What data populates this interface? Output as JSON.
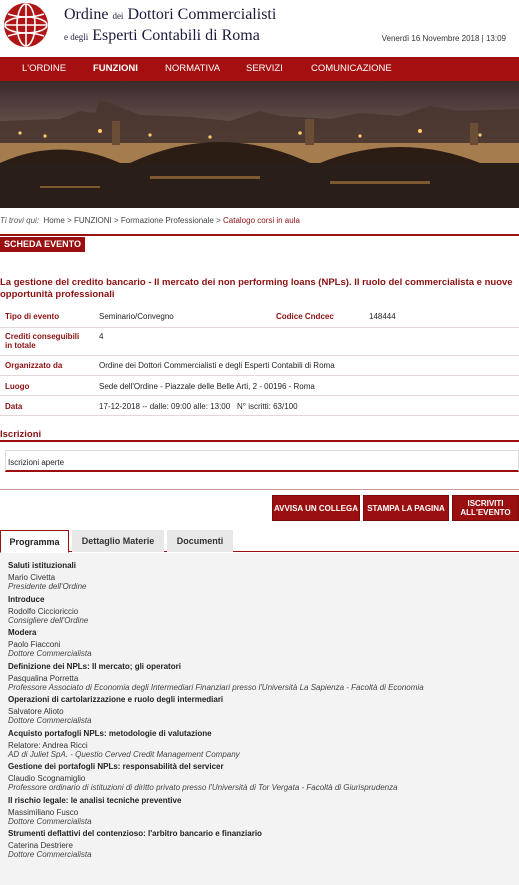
{
  "header": {
    "org_line1": "Ordine",
    "org_line1_small": "dei",
    "org_line1_rest": "Dottori Commercialisti",
    "org_line2_small": "e degli",
    "org_line2_rest": "Esperti Contabili di Roma",
    "date": "Venerdì 16 Novembre 2018 | 13:09",
    "logo_icon": "globe-logo-icon"
  },
  "nav": [
    "L'ORDINE",
    "FUNZIONI",
    "NORMATIVA",
    "SERVIZI",
    "COMUNICAZIONE"
  ],
  "breadcrumb": {
    "label": "Ti trovi qui:",
    "items": [
      "Home",
      "FUNZIONI",
      "Formazione Professionale"
    ],
    "current": "Catalogo corsi in aula",
    "sep": ">"
  },
  "scheda_label": "SCHEDA EVENTO",
  "event": {
    "title": "La gestione del credito bancario - Il mercato dei non performing loans (NPLs). Il ruolo del commercialista e nuove opportunità professionali",
    "tipo_label": "Tipo di evento",
    "tipo_value": "Seminario/Convegno",
    "codice_label": "Codice Cndcec",
    "codice_value": "148444",
    "crediti_label": "Crediti conseguibili in totale",
    "crediti_value": "4",
    "organizzato_label": "Organizzato da",
    "organizzato_value": "Ordine dei Dottori Commercialisti e degli Esperti Contabili di Roma",
    "luogo_label": "Luogo",
    "luogo_value": "Sede dell'Ordine - Piazzale delle Belle Arti, 2 - 00196 - Roma",
    "data_label": "Data",
    "data_value": "17-12-2018 -- dalle: 09:00 alle: 13:00",
    "iscritti_value": "N° iscritti: 63/100"
  },
  "iscrizioni": {
    "title": "Iscrizioni",
    "status": "Iscrizioni aperte"
  },
  "buttons": {
    "avvisa": "AVVISA UN COLLEGA",
    "stampa": "STAMPA LA PAGINA",
    "iscriviti": "ISCRIVITI ALL'EVENTO"
  },
  "tabs": [
    "Programma",
    "Dettaglio Materie",
    "Documenti"
  ],
  "programma": [
    {
      "t": "h",
      "text": "Saluti istituzionali"
    },
    {
      "t": "n",
      "text": "Mario Civetta"
    },
    {
      "t": "r",
      "text": "Presidente dell'Ordine"
    },
    {
      "t": "h",
      "text": "Introduce"
    },
    {
      "t": "n",
      "text": "Rodolfo Ciccioriccio"
    },
    {
      "t": "r",
      "text": "Consigliere dell'Ordine"
    },
    {
      "t": "h",
      "text": "Modera"
    },
    {
      "t": "n",
      "text": "Paolo Fiacconi"
    },
    {
      "t": "r",
      "text": "Dottore Commercialista"
    },
    {
      "t": "h",
      "text": "Definizione dei NPLs:  Il mercato; gli operatori"
    },
    {
      "t": "n",
      "text": "Pasqualina Porretta"
    },
    {
      "t": "r",
      "text": "Professore Associato di Economia degli Intermediari Finanziari presso l'Università La Sapienza - Facoltà di Economia"
    },
    {
      "t": "h",
      "text": "Operazioni di cartolarizzazione e ruolo degli intermediari"
    },
    {
      "t": "n",
      "text": "Salvatore Alioto"
    },
    {
      "t": "r",
      "text": "Dottore Commercialista"
    },
    {
      "t": "h",
      "text": "Acquisto portafogli NPLs: metodologie di valutazione"
    },
    {
      "t": "n",
      "text": "Relatore: Andrea Ricci"
    },
    {
      "t": "r",
      "text": "AD di Juliet SpA. - Questio Cerved Credit Management Company"
    },
    {
      "t": "h",
      "text": "Gestione dei portafogli NPLs: responsabilità del servicer"
    },
    {
      "t": "n",
      "text": "Claudio Scognamiglio"
    },
    {
      "t": "r",
      "text": "Professore ordinario di istituzioni di diritto privato presso l'Università di Tor Vergata - Facoltà di Giurisprudenza"
    },
    {
      "t": "h",
      "text": "Il rischio legale: le analisi tecniche preventive"
    },
    {
      "t": "n",
      "text": "Massimiliano Fusco"
    },
    {
      "t": "r",
      "text": "Dottore Commercialista"
    },
    {
      "t": "h",
      "text": "Strumenti deflattivi del contenzioso: l'arbitro bancario e finanziario"
    },
    {
      "t": "n",
      "text": "Caterina Destriere"
    },
    {
      "t": "r",
      "text": "Dottore Commercialista"
    }
  ]
}
